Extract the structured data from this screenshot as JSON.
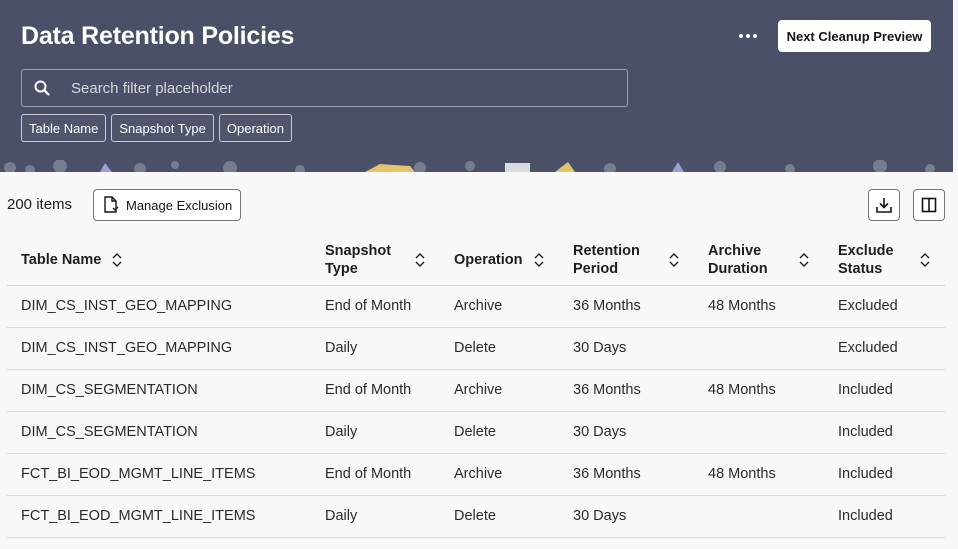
{
  "header": {
    "title": "Data Retention Policies",
    "more_icon": "more-horizontal-icon",
    "preview_button": "Next Cleanup Preview",
    "search_placeholder": "Search filter placeholder",
    "chips": [
      "Table Name",
      "Snapshot Type",
      "Operation"
    ],
    "background_color": "#4b5068"
  },
  "toolbar": {
    "count_label": "200 items",
    "manage_button": "Manage Exclusion",
    "download_icon": "download-icon",
    "columns_icon": "columns-icon"
  },
  "table": {
    "headers": [
      "Table Name",
      "Snapshot Type",
      "Operation",
      "Retention Period",
      "Archive Duration",
      "Exclude Status"
    ],
    "rows": [
      [
        "DIM_CS_INST_GEO_MAPPING",
        "End of Month",
        "Archive",
        "36 Months",
        "48 Months",
        "Excluded"
      ],
      [
        "DIM_CS_INST_GEO_MAPPING",
        "Daily",
        "Delete",
        "30 Days",
        "",
        "Excluded"
      ],
      [
        "DIM_CS_SEGMENTATION",
        "End of Month",
        "Archive",
        "36 Months",
        "48 Months",
        "Included"
      ],
      [
        "DIM_CS_SEGMENTATION",
        "Daily",
        "Delete",
        "30 Days",
        "",
        "Included"
      ],
      [
        "FCT_BI_EOD_MGMT_LINE_ITEMS",
        "End of Month",
        "Archive",
        "36 Months",
        "48 Months",
        "Included"
      ],
      [
        "FCT_BI_EOD_MGMT_LINE_ITEMS",
        "Daily",
        "Delete",
        "30 Days",
        "",
        "Included"
      ]
    ]
  }
}
